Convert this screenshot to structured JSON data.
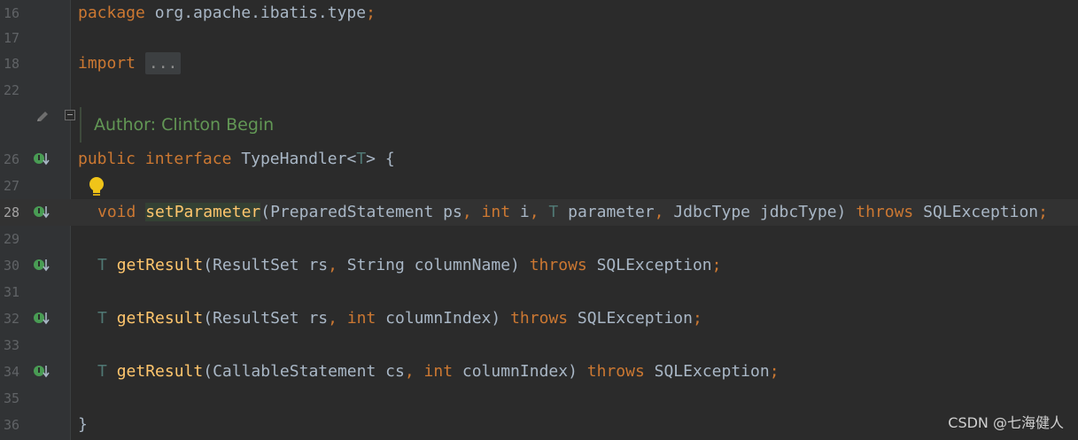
{
  "gutter": {
    "line_numbers": [
      "16",
      "17",
      "18",
      "22",
      "",
      "26",
      "27",
      "28",
      "29",
      "30",
      "31",
      "32",
      "33",
      "34",
      "35",
      "36"
    ],
    "current_line": "28"
  },
  "code": {
    "package_kw": "package",
    "package_name": " org.apache.ibatis.type",
    "semicolon": ";",
    "import_kw": "import",
    "import_folded": "...",
    "doc_author": "Author: Clinton Begin",
    "public_kw": "public",
    "interface_kw": "interface",
    "interface_name": "TypeHandler",
    "lt": "<",
    "type_param": "T",
    "gt_brace": "> {",
    "void_kw": "void",
    "set_parameter": "setParameter",
    "open_paren": "(",
    "prepared_statement": "PreparedStatement ps",
    "comma": ",",
    "int_kw": "int",
    "i_param": " i",
    "t_type": "T",
    "parameter": " parameter",
    "jdbc_type": " JdbcType jdbcType)",
    "throws_kw": "throws",
    "sql_exception": " SQLException",
    "get_result": "getResult",
    "resultset_rs": "ResultSet rs",
    "string_column": " String columnName)",
    "column_index": " columnIndex)",
    "callable_cs": "CallableStatement cs",
    "close_brace": "}"
  },
  "watermark": "CSDN @七海健人",
  "colors": {
    "background": "#2b2b2b",
    "keyword": "#cc7832",
    "method": "#ffc66d",
    "type_param": "#507874",
    "doc_comment": "#629755",
    "impl_icon": "#499c54"
  },
  "icons": [
    "edit-pencil-icon",
    "implemented-method-icon",
    "lightbulb-icon",
    "fold-toggle-icon"
  ]
}
